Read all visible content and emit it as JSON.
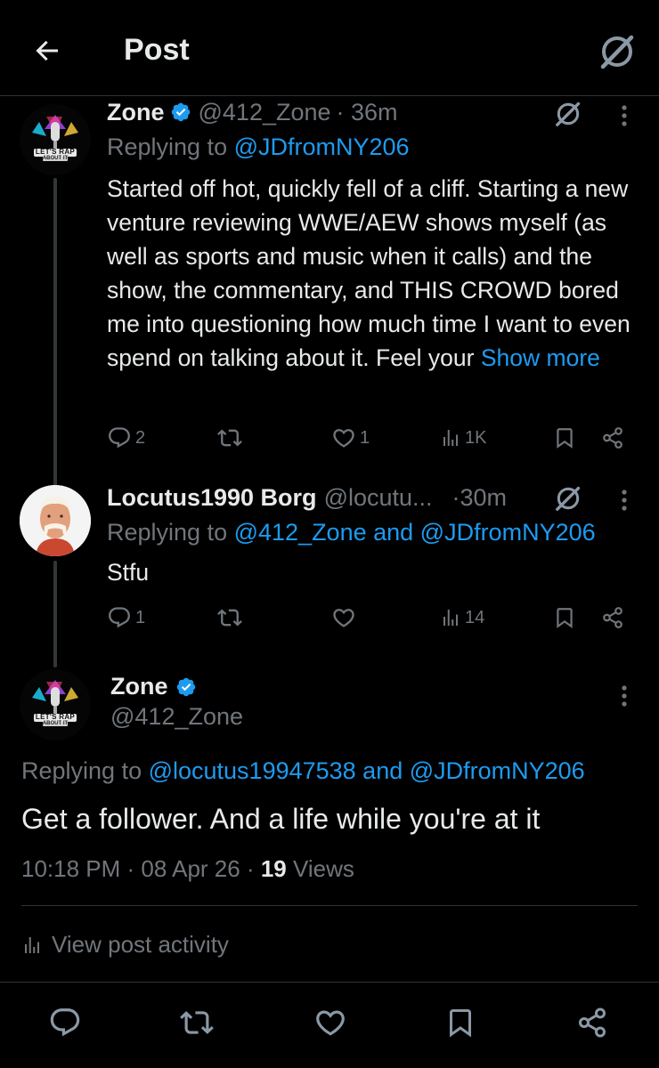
{
  "header": {
    "title": "Post"
  },
  "tweet1": {
    "name": "Zone",
    "handle": "@412_Zone",
    "time": "· 36m",
    "replying_prefix": "Replying to ",
    "replying_to": "@JDfromNY206",
    "text": "Started off hot, quickly fell of a cliff. Starting a new venture reviewing WWE/AEW shows myself (as well as sports and music when it calls) and the show, the commentary, and THIS CROWD bored me into questioning how much time I want to even spend on talking about it. Feel your",
    "show_more": "Show more",
    "replies": "2",
    "retweets": "",
    "likes": "1",
    "views": "1K"
  },
  "tweet2": {
    "name": "Locutus1990 Borg",
    "handle": "@locutu...",
    "time": "·30m",
    "replying_prefix": "Replying to ",
    "replying_to": "@412_Zone and @JDfromNY206",
    "text": "Stfu",
    "replies": "1",
    "retweets": "",
    "likes": "",
    "views": "14"
  },
  "main": {
    "name": "Zone",
    "handle": "@412_Zone",
    "replying_prefix": "Replying to ",
    "replying_to": "@locutus19947538 and @JDfromNY206",
    "text": "Get a follower. And a life while you're at it",
    "time": "10:18 PM · 08 Apr 26 · ",
    "views_count": "19",
    "views_label": " Views",
    "activity": "View post activity"
  },
  "avatar_logo": {
    "line1": "LET'S RAP",
    "line2": "ABOUT IT"
  },
  "colors": {
    "accent": "#1d9bf0",
    "muted": "#71767b",
    "text": "#e7e9ea",
    "background": "#000000"
  }
}
